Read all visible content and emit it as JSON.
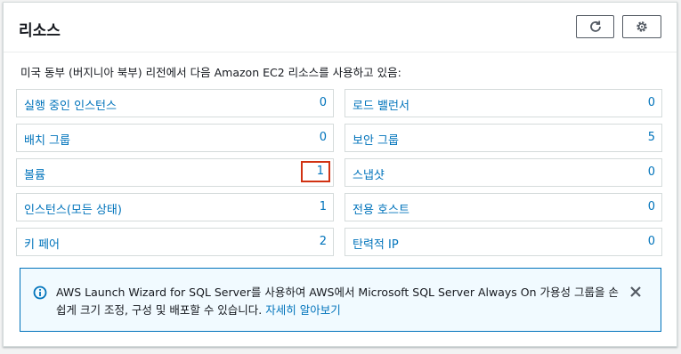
{
  "resources": {
    "title": "리소스",
    "description": "미국 동부 (버지니아 북부) 리전에서 다음 Amazon EC2 리소스를 사용하고 있음:",
    "items": [
      {
        "label": "실행 중인 인스턴스",
        "count": "0"
      },
      {
        "label": "로드 밸런서",
        "count": "0"
      },
      {
        "label": "배치 그룹",
        "count": "0"
      },
      {
        "label": "보안 그룹",
        "count": "5"
      },
      {
        "label": "볼륨",
        "count": "1"
      },
      {
        "label": "스냅샷",
        "count": "0"
      },
      {
        "label": "인스턴스(모든 상태)",
        "count": "1"
      },
      {
        "label": "전용 호스트",
        "count": "0"
      },
      {
        "label": "키 페어",
        "count": "2"
      },
      {
        "label": "탄력적 IP",
        "count": "0"
      }
    ]
  },
  "info_banner": {
    "text": "AWS Launch Wizard for SQL Server를 사용하여 AWS에서 Microsoft SQL Server Always On 가용성 그룹을 손쉽게 크기 조정, 구성 및 배포할 수 있습니다. ",
    "link": "자세히 알아보기"
  },
  "colors": {
    "link": "#0073bb",
    "highlight": "#d13212",
    "info_bg": "#f1faff"
  },
  "icons": {
    "refresh": "refresh-icon",
    "settings": "gear-icon",
    "info": "info-icon",
    "close": "close-icon"
  }
}
